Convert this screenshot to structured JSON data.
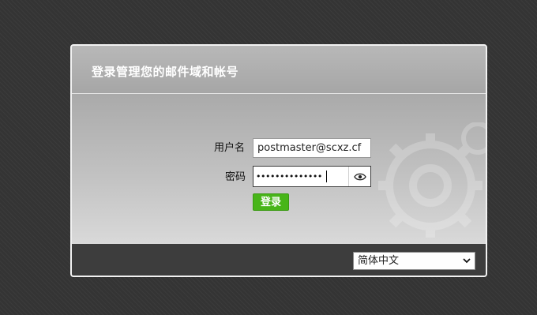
{
  "header": {
    "title": "登录管理您的邮件域和帐号"
  },
  "form": {
    "username_label": "用户名",
    "username_value": "postmaster@scxz.cf",
    "password_label": "密码",
    "password_mask": "••••••••••••••",
    "login_label": "登录"
  },
  "footer": {
    "language_selected": "简体中文"
  },
  "icons": {
    "password_toggle": "eye-icon",
    "language_dropdown": "chevron-down-icon",
    "background_decoration": "gears-icon"
  },
  "colors": {
    "login_button": "#48b519",
    "page_background": "#343434",
    "footer_bar": "#3d3d3d"
  }
}
